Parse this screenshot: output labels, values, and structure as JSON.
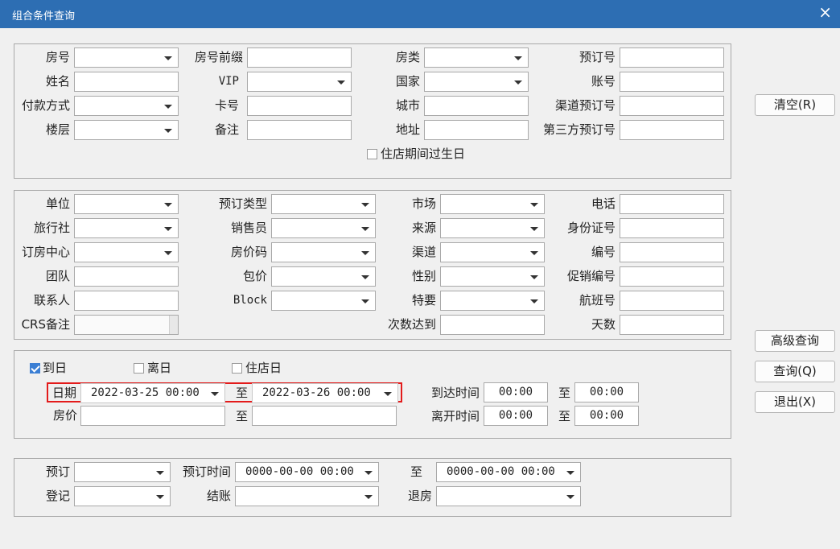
{
  "window": {
    "title": "组合条件查询",
    "close_icon": "×"
  },
  "group1": {
    "labels": {
      "room_no": "房号",
      "room_prefix": "房号前缀",
      "room_type": "房类",
      "booking_no": "预订号",
      "name": "姓名",
      "vip": "VIP",
      "country": "国家",
      "account_no": "账号",
      "payment": "付款方式",
      "card_no": "卡号",
      "city": "城市",
      "channel_booking_no": "渠道预订号",
      "floor": "楼层",
      "remark": "备注",
      "address": "地址",
      "third_party_booking_no": "第三方预订号"
    },
    "birthday_checkbox": {
      "label": "住店期间过生日",
      "checked": false
    }
  },
  "group2": {
    "labels": {
      "unit": "单位",
      "booking_type": "预订类型",
      "market": "市场",
      "phone": "电话",
      "travel_agency": "旅行社",
      "salesperson": "销售员",
      "source": "来源",
      "id_no": "身份证号",
      "booking_center": "订房中心",
      "rate_code": "房价码",
      "channel": "渠道",
      "number": "编号",
      "group": "团队",
      "package": "包价",
      "gender": "性别",
      "promo_no": "促销编号",
      "contact": "联系人",
      "block": "Block",
      "special": "特要",
      "flight_no": "航班号",
      "crs_remark": "CRS备注",
      "times_reached": "次数达到",
      "days": "天数"
    }
  },
  "group3": {
    "arrival_checkbox": {
      "label": "到日",
      "checked": true
    },
    "departure_checkbox": {
      "label": "离日",
      "checked": false
    },
    "stay_checkbox": {
      "label": "住店日",
      "checked": false
    },
    "date_label": "日期",
    "date_from": "2022-03-25 00:00",
    "to_label": "至",
    "date_to": "2022-03-26 00:00",
    "rate_label": "房价",
    "rate_from": "",
    "rate_to": "",
    "arrival_time_label": "到达时间",
    "arrival_time_from": "00:00",
    "arrival_time_to": "00:00",
    "departure_time_label": "离开时间",
    "departure_time_from": "00:00",
    "departure_time_to": "00:00"
  },
  "group4": {
    "booking_label": "预订",
    "booking_time_label": "预订时间",
    "booking_time_from": "0000-00-00 00:00",
    "to_label": "至",
    "booking_time_to": "0000-00-00 00:00",
    "checkin_label": "登记",
    "checkout_label": "结账",
    "return_label": "退房"
  },
  "buttons": {
    "clear": "清空(R)",
    "advanced": "高级查询",
    "query": "查询(Q)",
    "exit": "退出(X)"
  },
  "colors": {
    "titlebar": "#2d6eb3",
    "highlight": "#e31b1b",
    "checkbox_checked": "#3b7fd4"
  }
}
